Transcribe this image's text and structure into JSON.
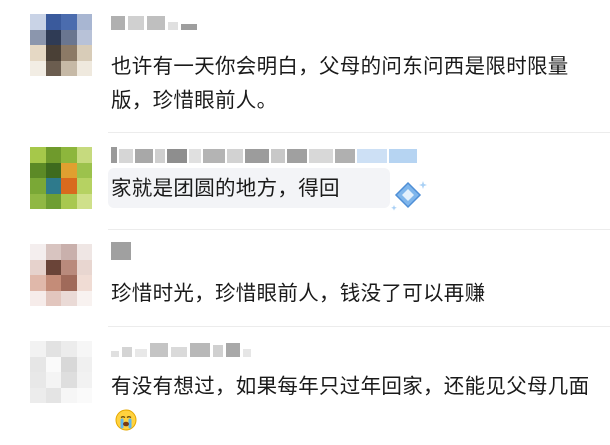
{
  "comments": [
    {
      "text": "也许有一天你会明白，父母的问东问西是限时限量版，珍惜眼前人。"
    },
    {
      "text": "家就是团圆的地方，得回"
    },
    {
      "text": "珍惜时光，珍惜眼前人，钱没了可以再赚"
    },
    {
      "text": "有没有想过，如果每年只过年回家，还能见父母几面",
      "emoji": "crying-face-emoji"
    }
  ],
  "colors": {
    "text": "#1a1a1a",
    "bubble_bg": "#f3f4f7",
    "divider": "#ececec",
    "sticker_blue": "#7fb6ec"
  }
}
